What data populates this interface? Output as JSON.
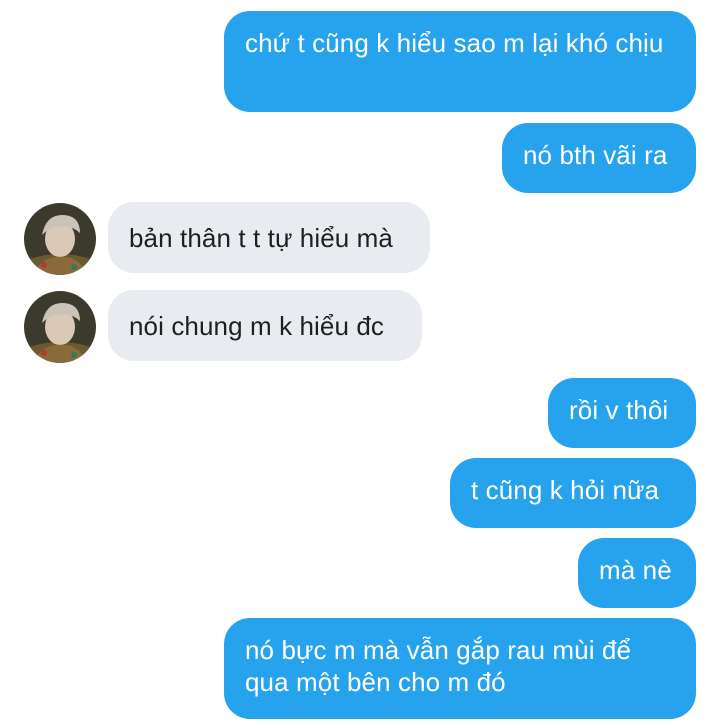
{
  "conversation": {
    "messages": [
      {
        "direction": "outgoing",
        "text": "chứ t cũng k hiểu sao m lại khó chịu"
      },
      {
        "direction": "outgoing",
        "text": "nó bth vãi ra"
      },
      {
        "direction": "incoming",
        "text": "bản thân t t tự hiểu mà"
      },
      {
        "direction": "incoming",
        "text": "nói chung m k hiểu đc"
      },
      {
        "direction": "outgoing",
        "text": "rồi v thôi"
      },
      {
        "direction": "outgoing",
        "text": "t cũng k hỏi nữa"
      },
      {
        "direction": "outgoing",
        "text": "mà nè"
      },
      {
        "direction": "outgoing",
        "text": "nó bực m mà vẫn gắp rau mùi để qua một bên cho m đó"
      }
    ]
  },
  "colors": {
    "outgoing_bubble": "#27a3ee",
    "incoming_bubble": "#e8ebef",
    "outgoing_text": "#ffffff",
    "incoming_text": "#1f1f1f",
    "background": "#ffffff"
  },
  "icons": {
    "contact_avatar": "contact-avatar-photo"
  }
}
